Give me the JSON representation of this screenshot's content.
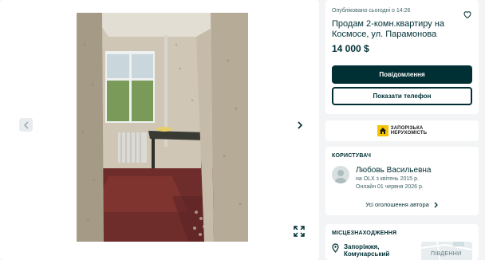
{
  "listing": {
    "published": "Опубліковано сьогодні о 14:26",
    "title": "Продам 2-комн.квартиру на Космосе, ул. Парамонова",
    "price": "14 000 $",
    "message_button": "Повідомлення",
    "phone_button": "Показати телефон"
  },
  "brand": {
    "name_line1": "ЗАПОРІЗЬКА",
    "name_line2": "НЕРУХОМІСТЬ"
  },
  "user": {
    "section_label": "КОРИСТУВАЧ",
    "name": "Любовь Васильевна",
    "since": "на OLX з квітень 2015 р.",
    "online": "Онлайн 01 червня 2026 р.",
    "all_ads": "Усі оголошення автора"
  },
  "location": {
    "section_label": "МІСЦЕЗНАХОДЖЕННЯ",
    "city": "Запоріжжя,",
    "district": "Комунарський",
    "map_label": "ПІВДЕННИ"
  },
  "icons": {
    "prev": "chevron-left-icon",
    "next": "chevron-right-icon",
    "fullscreen": "expand-icon",
    "favorite": "heart-icon",
    "location": "map-pin-icon",
    "user": "avatar-icon"
  },
  "colors": {
    "primary": "#002f34",
    "background": "#f2f4f5",
    "muted_text": "#406367",
    "brand_yellow": "#f5c400"
  }
}
